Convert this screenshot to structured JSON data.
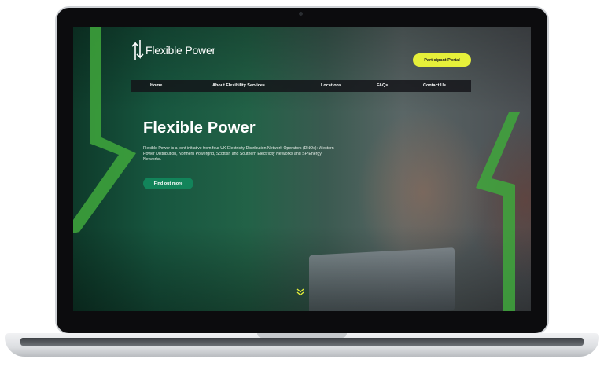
{
  "site": {
    "logo_text": "Flexible Power",
    "portal_button": "Participant Portal"
  },
  "nav": {
    "items": [
      {
        "label": "Home"
      },
      {
        "label": "About Flexibility Services"
      },
      {
        "label": "Locations"
      },
      {
        "label": "FAQs"
      },
      {
        "label": "Contact Us"
      }
    ]
  },
  "hero": {
    "title": "Flexible Power",
    "body": "Flexible Power is a joint initiative from four UK Electricity Distribution Network Operators (DNOs): Western Power Distribution, Northern Powergrid, Scottish and Southern Electricity Networks and SP Energy Networks.",
    "cta_label": "Find out more"
  },
  "icons": {
    "logo": "up-down-arrows-icon",
    "scroll": "double-chevron-down-icon"
  },
  "colors": {
    "accent_yellow": "#e6f03a",
    "cta_green": "#12845a",
    "brand_green": "#3fa73c"
  }
}
